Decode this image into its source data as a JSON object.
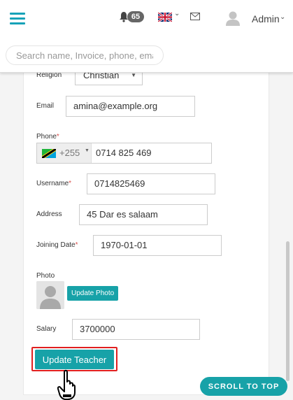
{
  "header": {
    "notification_count": "65",
    "language_flag": "uk-flag-icon",
    "user_name": "Admin",
    "search_placeholder": "Search name, Invoice, phone, ema"
  },
  "form": {
    "religion": {
      "label": "Religion",
      "value": "Christian"
    },
    "email": {
      "label": "Email",
      "value": "amina@example.org"
    },
    "phone": {
      "label": "Phone",
      "required": "*",
      "dial_code": "+255",
      "value": "0714 825 469"
    },
    "username": {
      "label": "Username",
      "required": "*",
      "value": "0714825469"
    },
    "address": {
      "label": "Address",
      "value": "45 Dar es salaam"
    },
    "joining_date": {
      "label": "Joining Date",
      "required": "*",
      "value": "1970-01-01"
    },
    "photo": {
      "label": "Photo",
      "button": "Update Photo"
    },
    "salary": {
      "label": "Salary",
      "value": "3700000"
    },
    "submit": "Update Teacher"
  },
  "scroll_top": "SCROLL TO TOP",
  "colors": {
    "accent": "#17a2a8",
    "highlight": "#e02020",
    "required": "#d9534f"
  }
}
